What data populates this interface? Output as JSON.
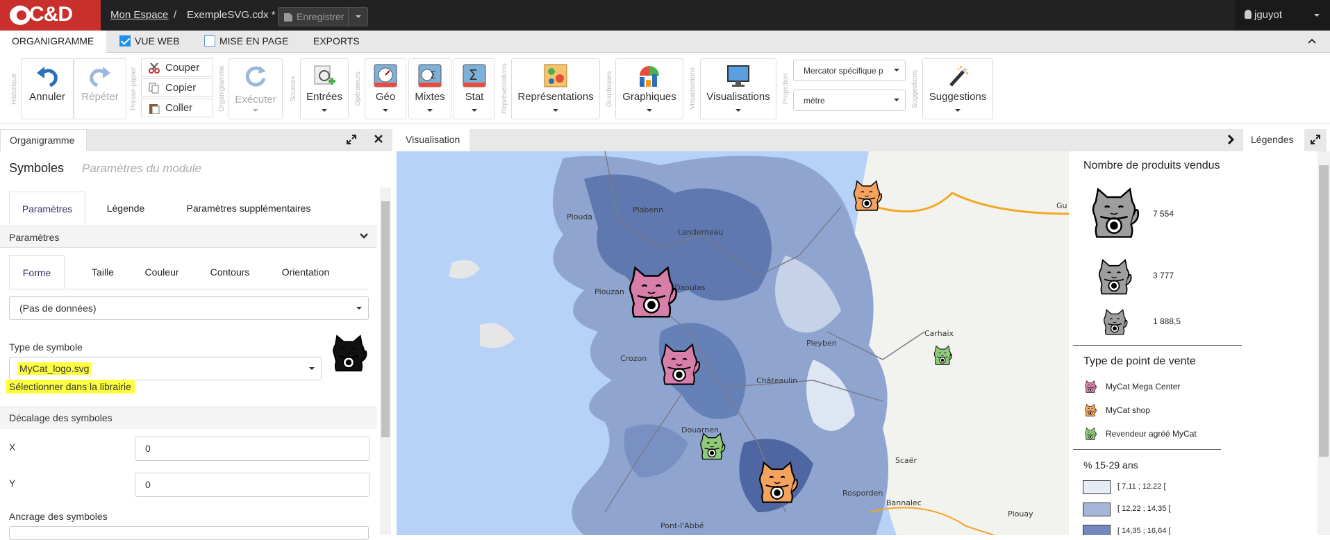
{
  "app": {
    "brand": "C&D",
    "crumb_home": "Mon Espace",
    "crumb_sep": "/",
    "file": "ExempleSVG.cdx *",
    "save": "Enregistrer",
    "user": "jguyot"
  },
  "menu": {
    "tabs": [
      "ORGANIGRAMME",
      "VUE WEB",
      "MISE EN PAGE",
      "EXPORTS"
    ],
    "vue_web_checked": true,
    "mise_en_page_checked": false
  },
  "ribbon": {
    "groups": [
      "Historique",
      "Presse-papier",
      "Organigramme",
      "Sources",
      "Opérateurs",
      "Représentations",
      "Graphiques",
      "Visualisations",
      "Projection",
      "Suggestions"
    ],
    "annuler": "Annuler",
    "repeter": "Répéter",
    "couper": "Couper",
    "copier": "Copier",
    "coller": "Coller",
    "executer": "Exécuter",
    "entrees": "Entrées",
    "geo": "Géo",
    "mixtes": "Mixtes",
    "stat": "Stat",
    "representations": "Représentations",
    "graphiques": "Graphiques",
    "visualisations": "Visualisations",
    "projection": "Mercator spécifique p",
    "unite": "mètre",
    "suggestions": "Suggestions"
  },
  "left": {
    "tab": "Organigramme",
    "title": "Symboles",
    "subtitle": "Paramètres du module",
    "tabs1": [
      "Paramètres",
      "Légende",
      "Paramètres supplémentaires"
    ],
    "params": "Paramètres",
    "tabs2": [
      "Forme",
      "Taille",
      "Couleur",
      "Contours",
      "Orientation"
    ],
    "data_select": "(Pas de données)",
    "type_label": "Type de symbole",
    "type_value": "MyCat_logo.svg",
    "library_link": "Sélectionner dans la librairie",
    "decalage": "Décalage des symboles",
    "x_label": "X",
    "x_value": "0",
    "y_label": "Y",
    "y_value": "0",
    "ancrage": "Ancrage des symboles"
  },
  "vis": {
    "tab": "Visualisation",
    "legend_tab": "Légendes"
  },
  "map_labels": [
    "Gu",
    "Plouda",
    "Plabenn",
    "Landerneau",
    "Plouzan",
    "Daoulas",
    "Crozon",
    "Châteaulin",
    "Douarnen",
    "Pleyben",
    "Carhaix",
    "Scaër",
    "Rosporden",
    "Bannalec",
    "Plouay",
    "Pont-l'Abbé"
  ],
  "legend": {
    "size_title": "Nombre de produits vendus",
    "sizes": [
      "7 554",
      "3 777",
      "1 888,5"
    ],
    "type_title": "Type de point de vente",
    "types": [
      {
        "label": "MyCat Mega Center",
        "color": "#d77fa9"
      },
      {
        "label": "MyCat shop",
        "color": "#f4a35f"
      },
      {
        "label": "Revendeur agréé MyCat",
        "color": "#8fc97a"
      }
    ],
    "pct_title": "% 15-29 ans",
    "classes": [
      {
        "label": "[ 7,11 ; 12,22 [",
        "color": "#e6ecf6"
      },
      {
        "label": "[ 12,22 ; 14,35 [",
        "color": "#a5b7d8"
      },
      {
        "label": "[ 14,35 ; 16,64 [",
        "color": "#7189bd"
      }
    ]
  },
  "colors": {
    "brand_red": "#c9302c",
    "topbar": "#222222",
    "accent": "#1e90e8",
    "highlight": "#ffff40"
  }
}
